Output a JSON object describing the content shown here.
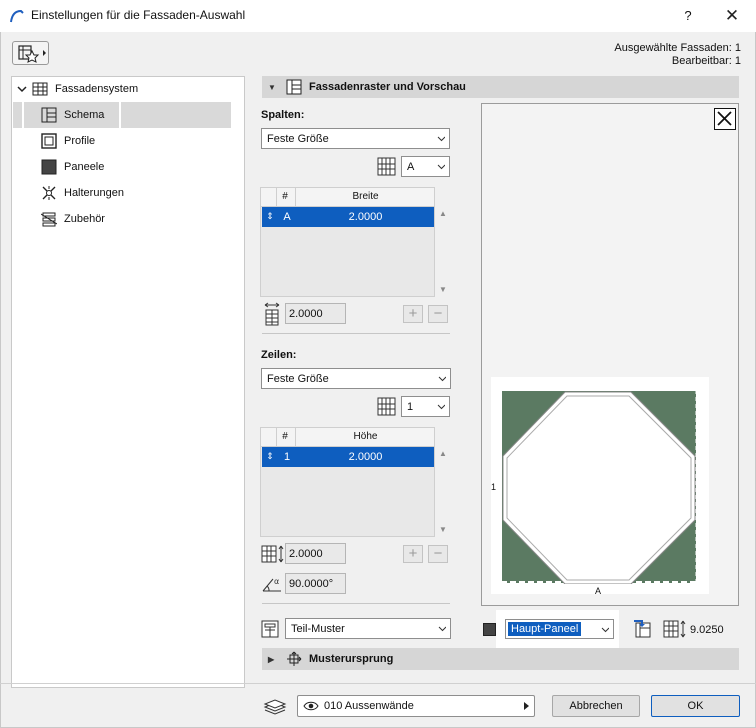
{
  "window": {
    "title": "Einstellungen für die Fassaden-Auswahl",
    "help_label": "?",
    "close_label": "✕"
  },
  "info": {
    "selected": "Ausgewählte Fassaden: 1",
    "editable": "Bearbeitbar: 1"
  },
  "tree": {
    "root": "Fassadensystem",
    "items": [
      {
        "label": "Schema",
        "icon": "schema-icon",
        "selected": true
      },
      {
        "label": "Profile",
        "icon": "profile-icon"
      },
      {
        "label": "Paneele",
        "icon": "panel-icon"
      },
      {
        "label": "Halterungen",
        "icon": "bracket-icon"
      },
      {
        "label": "Zubehör",
        "icon": "accessory-icon"
      }
    ]
  },
  "section_grid": {
    "title": "Fassadenraster und Vorschau"
  },
  "columns": {
    "label": "Spalten:",
    "mode": "Feste Größe",
    "ref": "A",
    "table_headers": [
      "#",
      "Breite"
    ],
    "rows": [
      {
        "id": "A",
        "value": "2.0000"
      }
    ],
    "size_value": "2.0000",
    "plus": "+",
    "minus": "−"
  },
  "rows": {
    "label": "Zeilen:",
    "mode": "Feste Größe",
    "ref": "1",
    "table_headers": [
      "#",
      "Höhe"
    ],
    "rows": [
      {
        "id": "1",
        "value": "2.0000"
      }
    ],
    "size_value": "2.0000",
    "angle_value": "90.0000°",
    "plus": "+",
    "minus": "−"
  },
  "preview": {
    "col_label": "A",
    "row_label": "1",
    "panel_color": "#5b7a62"
  },
  "pattern": {
    "mode": "Teil-Muster",
    "panel": "Haupt-Paneel",
    "height_value": "9.0250"
  },
  "section_origin": {
    "title": "Musterursprung"
  },
  "footer": {
    "layer": "010 Aussenwände",
    "cancel": "Abbrechen",
    "ok": "OK"
  },
  "colors": {
    "accent": "#0e5ebf",
    "title_icon": "#1f5fbf"
  }
}
